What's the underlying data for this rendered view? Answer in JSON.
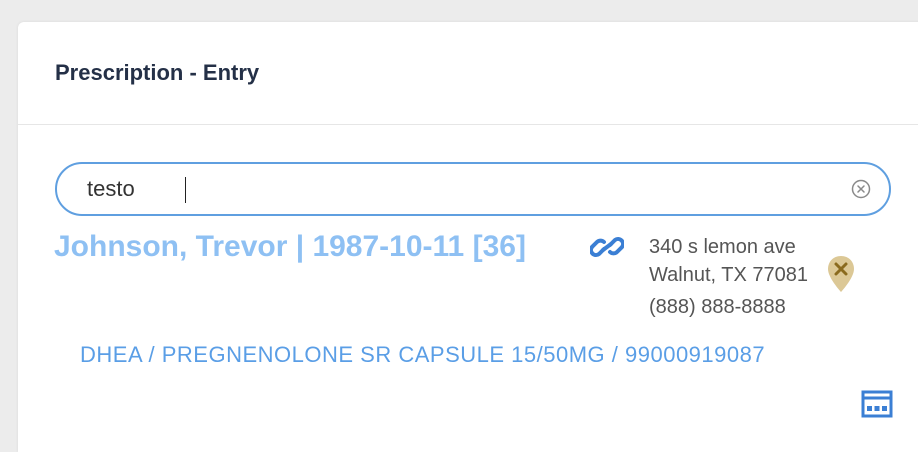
{
  "modal": {
    "title": "Prescription - Entry"
  },
  "search": {
    "value": "testo"
  },
  "patient": {
    "name_line": "Johnson, Trevor | 1987-10-11 [36]",
    "address_line1": "340 s lemon ave",
    "address_line2": "Walnut, TX 77081",
    "phone": "(888) 888-8888"
  },
  "prescription": {
    "line": "DHEA / PREGNENOLONE SR CAPSULE 15/50MG / 99000919087"
  },
  "icons": {
    "clear": "circle-x-icon",
    "link": "chain-link-icon",
    "pin": "map-pin-x-icon",
    "pack": "blister-pack-icon"
  },
  "colors": {
    "accent": "#5f9fe0",
    "patient_name": "#8ec0f3",
    "prescription_text": "#5a9ee6",
    "title_text": "#243047",
    "pin": "#d9c08a"
  }
}
